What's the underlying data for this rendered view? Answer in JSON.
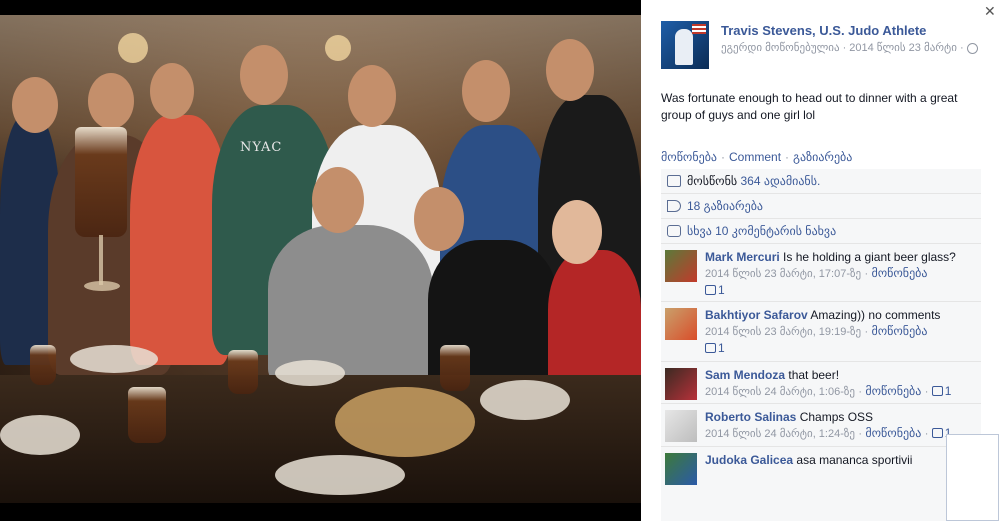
{
  "post": {
    "author": "Travis Stevens, U.S. Judo Athlete",
    "meta_text": "ეგერდი მოწონებულია",
    "date": "2014 წლის 23 მარტი",
    "text": "Was fortunate enough to head out to dinner with a great group of guys and one girl lol",
    "actions": {
      "like": "მოწონება",
      "comment": "Comment",
      "share": "გაზიარება"
    }
  },
  "stats": {
    "likes_label": "მოსწონს",
    "likes_count": "364 ადამიანს.",
    "shares": "18 გაზიარება",
    "more_comments": "სხვა 10 კომენტარის ნახვა"
  },
  "comments": [
    {
      "name": "Mark Mercuri",
      "text": "Is he holding a giant beer glass?",
      "time": "2014 წლის 23 მარტი, 17:07-ზე",
      "like": "მოწონება",
      "likes": "1"
    },
    {
      "name": "Bakhtiyor Safarov",
      "text": "Amazing)) no comments",
      "time": "2014 წლის 23 მარტი, 19:19-ზე",
      "like": "მოწონება",
      "likes": "1"
    },
    {
      "name": "Sam Mendoza",
      "text": "that beer!",
      "time": "2014 წლის 24 მარტი, 1:06-ზე",
      "like": "მოწონება",
      "likes": "1"
    },
    {
      "name": "Roberto Salinas",
      "text": "Champs OSS",
      "time": "2014 წლის 24 მარტი, 1:24-ზე",
      "like": "მოწონება",
      "likes": "1"
    },
    {
      "name": "Judoka Galicea",
      "text": "asa mananca sportivii",
      "time": "",
      "like": "",
      "likes": ""
    }
  ],
  "photo_text": {
    "shirt": "NYAC"
  },
  "colors": {
    "link": "#3b5998",
    "muted": "#9197a3",
    "panel": "#f6f7f8"
  },
  "icons": [
    "close-icon",
    "globe-icon",
    "like-icon",
    "share-icon",
    "comment-icon"
  ]
}
